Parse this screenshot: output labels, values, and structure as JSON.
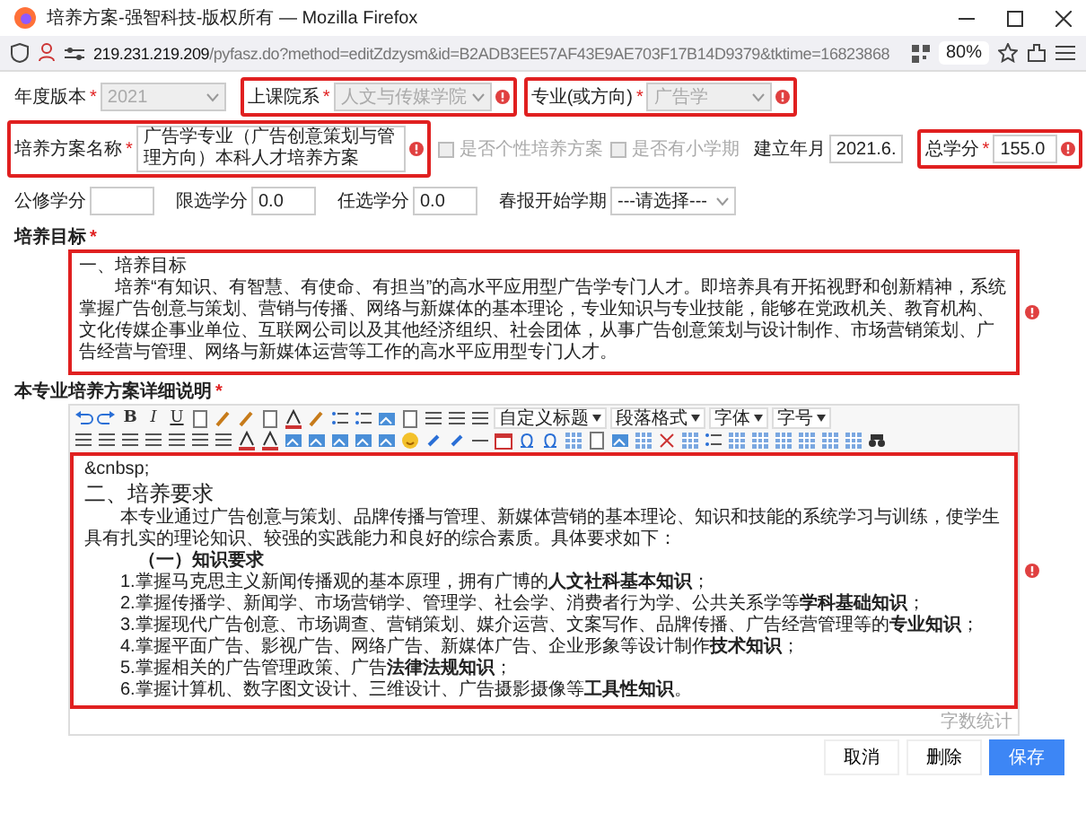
{
  "window": {
    "title": "培养方案-强智科技-版权所有 — Mozilla Firefox"
  },
  "address_bar": {
    "host": "219.231.219.209",
    "path": "/pyfasz.do?method=editZdzysm&id=B2ADB3EE57AF43E9AE703F17B14D9379&tktime=16823868",
    "zoom": "80%"
  },
  "form_rows": [
    [
      {
        "kind": "select",
        "label": "年度版本",
        "required_mark": "*",
        "value": "2021",
        "disabled": true,
        "highlighted": false,
        "error": false
      },
      {
        "kind": "select",
        "label": "上课院系",
        "required_mark": "*",
        "value": "人文与传媒学院",
        "disabled": true,
        "highlighted": true,
        "error": true
      },
      {
        "kind": "select",
        "label": "专业(或方向)",
        "required_mark": "*",
        "value": "广告学",
        "disabled": true,
        "highlighted": true,
        "error": true
      }
    ],
    [
      {
        "kind": "text",
        "label": "培养方案名称",
        "required_mark": "*",
        "value": "广告学专业（广告创意策划与管理方向）本科人才培养方案",
        "disabled": false,
        "highlighted": true,
        "error": true
      },
      {
        "kind": "checkbox",
        "label": "是否个性培养方案",
        "checked": false,
        "disabled": true
      },
      {
        "kind": "checkbox",
        "label": "是否有小学期",
        "checked": false,
        "disabled": true
      },
      {
        "kind": "text",
        "label": "建立年月",
        "value": "2021.6.",
        "disabled": false,
        "highlighted": false,
        "error": false
      },
      {
        "kind": "text",
        "label": "总学分",
        "required_mark": "*",
        "value": "155.0",
        "disabled": false,
        "highlighted": true,
        "error": true
      }
    ],
    [
      {
        "kind": "text",
        "label": "公修学分",
        "disabled": false,
        "highlighted": false,
        "error": false
      },
      {
        "kind": "text",
        "label": "限选学分",
        "value": "0.0",
        "disabled": false,
        "highlighted": false,
        "error": false
      },
      {
        "kind": "text",
        "label": "任选学分",
        "value": "0.0",
        "disabled": false,
        "highlighted": false,
        "error": false
      },
      {
        "kind": "select",
        "label": "春报开始学期",
        "value": "---请选择---",
        "disabled": false,
        "highlighted": false,
        "error": false
      }
    ]
  ],
  "goal": {
    "label": "培养目标",
    "required_mark": "*",
    "highlighted": true,
    "error": true,
    "heading": "一、培养目标",
    "text": "培养“有知识、有智慧、有使命、有担当”的高水平应用型广告学专门人才。即培养具有开拓视野和创新精神，系统掌握广告创意与策划、营销与传播、网络与新媒体的基本理论，专业知识与专业技能，能够在党政机关、教育机构、文化传媒企事业单位、互联网公司以及其他经济组织、社会团体，从事广告创意策划与设计制作、市场营销策划、广告经营与管理、网络与新媒体运营等工作的高水平应用型专门人才。"
  },
  "editor": {
    "label": "本专业培养方案详细说明",
    "required_mark": "*",
    "highlighted": true,
    "error": true,
    "format_buttons": [
      "B",
      "I",
      "U"
    ],
    "dropdowns": [
      "自定义标题",
      "段落格式",
      "字体",
      "字号"
    ],
    "content": [
      {
        "kind": "plain",
        "text": "&cnbsp;"
      },
      {
        "kind": "heading",
        "text": "二、培养要求"
      },
      {
        "kind": "paragraph",
        "text": "本专业通过广告创意与策划、品牌传播与管理、新媒体营销的基本理论、知识和技能的系统学习与训练，使学生具有扎实的理论知识、较强的实践能力和良好的综合素质。具体要求如下："
      },
      {
        "kind": "subheading",
        "text": "（一）知识要求"
      },
      {
        "kind": "item",
        "text": "1.掌握马克思主义新闻传播观的基本原理，拥有广博的**人文社科基本知识**；"
      },
      {
        "kind": "item",
        "text": "2.掌握传播学、新闻学、市场营销学、管理学、社会学、消费者行为学、公共关系学等**学科基础知识**；"
      },
      {
        "kind": "item",
        "text": "3.掌握现代广告创意、市场调查、营销策划、媒介运营、文案写作、品牌传播、广告经营管理等的**专业知识**；"
      },
      {
        "kind": "item",
        "text": "4.掌握平面广告、影视广告、网络广告、新媒体广告、企业形象等设计制作**技术知识**；"
      },
      {
        "kind": "item",
        "text": "5.掌握相关的广告管理政策、广告**法律法规知识**；"
      },
      {
        "kind": "item",
        "text": "6.掌握计算机、数字图文设计、三维设计、广告摄影摄像等**工具性知识**。"
      }
    ],
    "word_count": "字数统计"
  },
  "buttons": [
    {
      "kind": "default",
      "label": "取消"
    },
    {
      "kind": "default",
      "label": "删除"
    },
    {
      "kind": "primary",
      "label": "保存"
    }
  ]
}
